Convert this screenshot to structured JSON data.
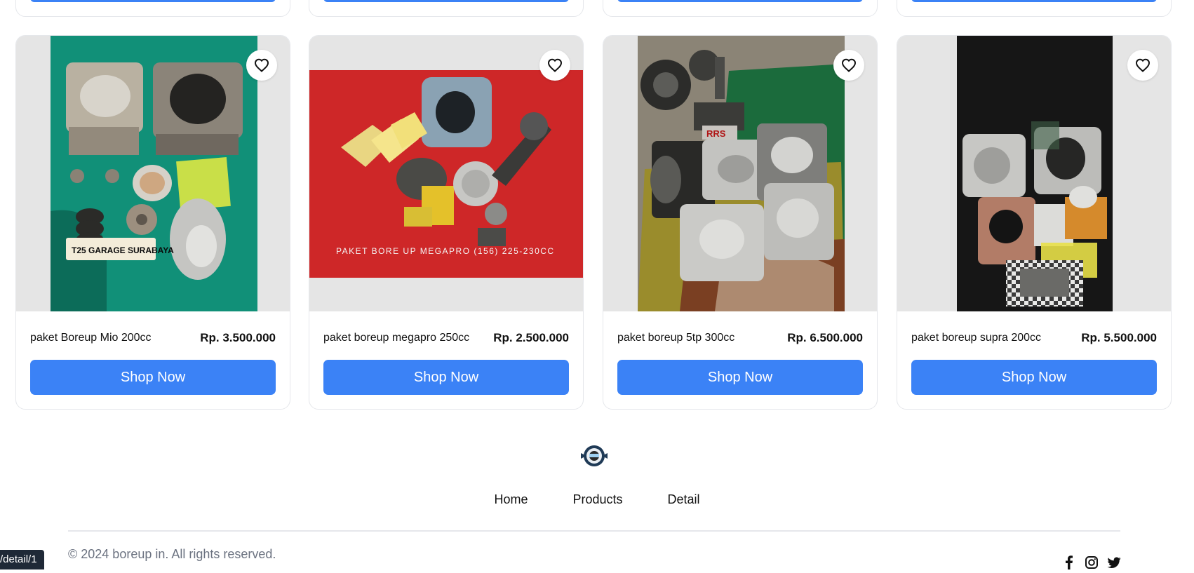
{
  "products": [
    {
      "name": "paket Boreup Mio 200cc",
      "price": "Rp. 3.500.000",
      "button": "Shop Now"
    },
    {
      "name": "paket boreup megapro 250cc",
      "price": "Rp. 2.500.000",
      "button": "Shop Now"
    },
    {
      "name": "paket boreup 5tp 300cc",
      "price": "Rp. 6.500.000",
      "button": "Shop Now"
    },
    {
      "name": "paket boreup supra 200cc",
      "price": "Rp. 5.500.000",
      "button": "Shop Now"
    }
  ],
  "image_texts": {
    "mio_badge": "T25 GARAGE SURABAYA",
    "megapro_caption": "PAKET BORE UP MEGAPRO (156) 225-230CC",
    "fivetp_tag": "RRS"
  },
  "footer": {
    "nav": [
      "Home",
      "Products",
      "Detail"
    ],
    "copyright": "© 2024 boreup in. All rights reserved.",
    "social_icons": [
      "facebook-icon",
      "instagram-icon",
      "twitter-icon"
    ]
  },
  "status_bar": {
    "url": "/detail/1"
  },
  "colors": {
    "accent": "#3b82f6",
    "image_bg": "#e5e5e5"
  }
}
